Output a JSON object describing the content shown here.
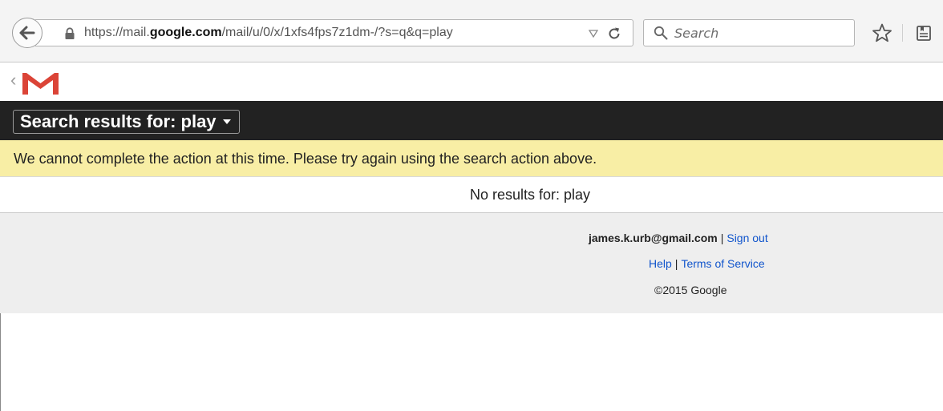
{
  "browser": {
    "url_prefix": "https://mail.",
    "url_domain": "google.com",
    "url_path": "/mail/u/0/x/1xfs4fps7z1dm-/?s=q&q=play",
    "search_placeholder": "Search"
  },
  "gmail": {
    "back_glyph": "‹",
    "title": "Search results for: play",
    "error_message": "We cannot complete the action at this time. Please try again using the search action above.",
    "no_results": "No results for: play"
  },
  "footer": {
    "email": "james.k.urb@gmail.com",
    "separator": "|",
    "sign_out": "Sign out",
    "help": "Help",
    "terms": "Terms of Service",
    "copyright": "©2015 Google"
  },
  "colors": {
    "title_bar": "#222222",
    "error_bar": "#f8eea5",
    "footer_bg": "#eeeeee",
    "link": "#1155cc",
    "gmail_red": "#db4437"
  },
  "icons": {
    "back": "back-arrow-icon",
    "lock": "lock-icon",
    "dropdown": "dropdown-triangle-icon",
    "reload": "reload-icon",
    "search": "search-icon",
    "bookmark": "star-icon",
    "reading_list": "reading-list-icon",
    "logo": "gmail-logo-icon",
    "caret": "caret-down-icon"
  }
}
